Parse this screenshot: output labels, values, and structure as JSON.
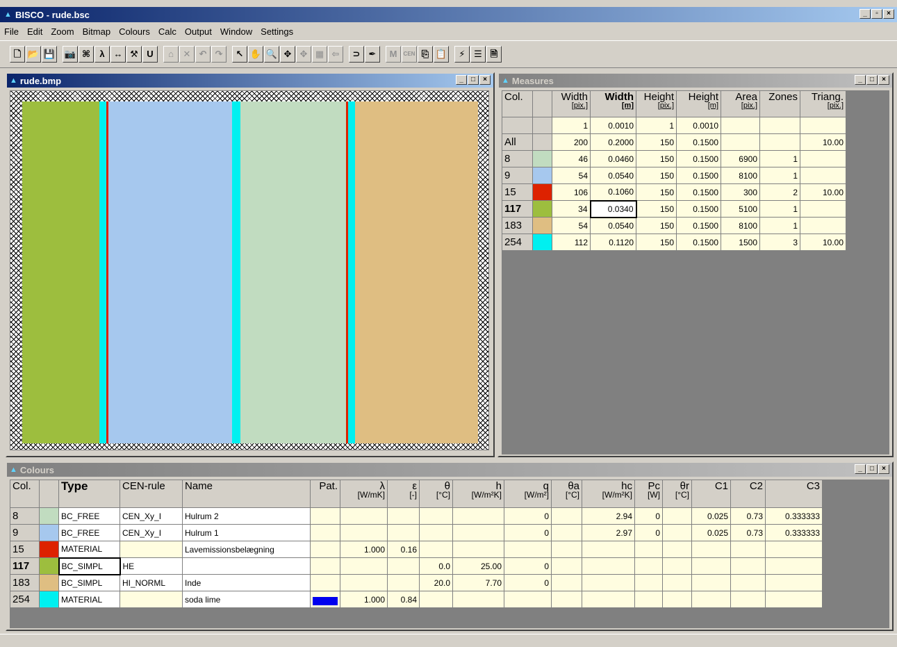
{
  "app": {
    "title": "BISCO - rude.bsc"
  },
  "menu": [
    "File",
    "Edit",
    "Zoom",
    "Bitmap",
    "Colours",
    "Calc",
    "Output",
    "Window",
    "Settings"
  ],
  "toolbar": [
    {
      "glyph": "🗋",
      "name": "new-icon"
    },
    {
      "glyph": "📂",
      "name": "open-icon"
    },
    {
      "glyph": "💾",
      "name": "save-icon"
    },
    {
      "sep": true
    },
    {
      "glyph": "📷",
      "name": "camera-icon"
    },
    {
      "glyph": "⌘",
      "name": "nodes-icon"
    },
    {
      "glyph": "λ",
      "name": "lambda-icon"
    },
    {
      "glyph": "↔",
      "name": "measure-icon"
    },
    {
      "glyph": "⚒",
      "name": "tools-icon"
    },
    {
      "glyph": "U",
      "name": "u-value-icon"
    },
    {
      "sep": true
    },
    {
      "glyph": "⌂",
      "name": "eraser-icon",
      "dis": true
    },
    {
      "glyph": "✕",
      "name": "delete-icon",
      "dis": true
    },
    {
      "glyph": "↶",
      "name": "undo-icon",
      "dis": true
    },
    {
      "glyph": "↷",
      "name": "redo-icon",
      "dis": true
    },
    {
      "sep": true
    },
    {
      "glyph": "↖",
      "name": "pointer-icon"
    },
    {
      "glyph": "✋",
      "name": "hand-icon"
    },
    {
      "glyph": "🔍",
      "name": "zoom-icon"
    },
    {
      "glyph": "✥",
      "name": "move-icon"
    },
    {
      "glyph": "✥",
      "name": "move2-icon",
      "dis": true
    },
    {
      "glyph": "▦",
      "name": "fill-icon",
      "dis": true
    },
    {
      "glyph": "⇦",
      "name": "back-icon",
      "dis": true
    },
    {
      "sep": true
    },
    {
      "glyph": "⊃",
      "name": "curve-icon"
    },
    {
      "glyph": "✒",
      "name": "brush-icon"
    },
    {
      "sep": true
    },
    {
      "glyph": "M",
      "name": "m-icon",
      "dis": true
    },
    {
      "glyph": "CEN",
      "name": "cen-icon",
      "dis": true,
      "small": true
    },
    {
      "glyph": "⎘",
      "name": "copy-icon"
    },
    {
      "glyph": "📋",
      "name": "paste-icon"
    },
    {
      "sep": true
    },
    {
      "glyph": "⚡",
      "name": "wand-icon"
    },
    {
      "glyph": "☰",
      "name": "colours-icon"
    },
    {
      "glyph": "🗎",
      "name": "report-icon"
    }
  ],
  "bitmap_window": {
    "title": "rude.bmp"
  },
  "measures_window": {
    "title": "Measures",
    "headers": [
      {
        "t": "Col.",
        "u": ""
      },
      {
        "t": "",
        "u": ""
      },
      {
        "t": "Width",
        "u": "[pix.]"
      },
      {
        "t": "Width",
        "u": "[m]",
        "bold": true
      },
      {
        "t": "Height",
        "u": "[pix.]"
      },
      {
        "t": "Height",
        "u": "[m]"
      },
      {
        "t": "Area",
        "u": "[pix.]"
      },
      {
        "t": "Zones",
        "u": ""
      },
      {
        "t": "Triang.",
        "u": "[pix.]"
      }
    ],
    "rows": [
      {
        "col": "",
        "color": "#d4d0c8",
        "v": [
          "1",
          "0.0010",
          "1",
          "0.0010",
          "",
          "",
          ""
        ]
      },
      {
        "col": "All",
        "color": "#d4d0c8",
        "v": [
          "200",
          "0.2000",
          "150",
          "0.1500",
          "",
          "",
          "10.00"
        ]
      },
      {
        "col": "8",
        "color": "#c1dcc0",
        "v": [
          "46",
          "0.0460",
          "150",
          "0.1500",
          "6900",
          "1",
          ""
        ]
      },
      {
        "col": "9",
        "color": "#a6c8ee",
        "v": [
          "54",
          "0.0540",
          "150",
          "0.1500",
          "8100",
          "1",
          ""
        ]
      },
      {
        "col": "15",
        "color": "#dd2200",
        "v": [
          "106",
          "0.1060",
          "150",
          "0.1500",
          "300",
          "2",
          "10.00"
        ]
      },
      {
        "col": "117",
        "color": "#9dbe3e",
        "v": [
          "34",
          "0.0340",
          "150",
          "0.1500",
          "5100",
          "1",
          ""
        ],
        "bold": true
      },
      {
        "col": "183",
        "color": "#dfbe82",
        "v": [
          "54",
          "0.0540",
          "150",
          "0.1500",
          "8100",
          "1",
          ""
        ]
      },
      {
        "col": "254",
        "color": "#00f0f0",
        "v": [
          "112",
          "0.1120",
          "150",
          "0.1500",
          "1500",
          "3",
          "10.00"
        ]
      }
    ]
  },
  "colours_window": {
    "title": "Colours",
    "headers": [
      {
        "t": "Col.",
        "u": ""
      },
      {
        "t": "",
        "u": ""
      },
      {
        "t": "Type",
        "u": "",
        "bold": true
      },
      {
        "t": "CEN-rule",
        "u": ""
      },
      {
        "t": "Name",
        "u": ""
      },
      {
        "t": "Pat.",
        "u": ""
      },
      {
        "t": "λ",
        "u": "[W/mK]"
      },
      {
        "t": "ε",
        "u": "[-]"
      },
      {
        "t": "θ",
        "u": "[°C]"
      },
      {
        "t": "h",
        "u": "[W/m²K]"
      },
      {
        "t": "q",
        "u": "[W/m²]"
      },
      {
        "t": "θa",
        "u": "[°C]"
      },
      {
        "t": "hc",
        "u": "[W/m²K]"
      },
      {
        "t": "Pc",
        "u": "[W]"
      },
      {
        "t": "θr",
        "u": "[°C]"
      },
      {
        "t": "C1",
        "u": ""
      },
      {
        "t": "C2",
        "u": ""
      },
      {
        "t": "C3",
        "u": ""
      }
    ],
    "rows": [
      {
        "col": "8",
        "color": "#c1dcc0",
        "type": "BC_FREE",
        "cen": "CEN_Xy_I",
        "name": "Hulrum 2",
        "pat": "",
        "v": [
          "",
          "",
          "",
          "",
          "0",
          "",
          "2.94",
          "0",
          "",
          "0.025",
          "0.73",
          "0.333333"
        ]
      },
      {
        "col": "9",
        "color": "#a6c8ee",
        "type": "BC_FREE",
        "cen": "CEN_Xy_I",
        "name": "Hulrum 1",
        "pat": "",
        "v": [
          "",
          "",
          "",
          "",
          "0",
          "",
          "2.97",
          "0",
          "",
          "0.025",
          "0.73",
          "0.333333"
        ]
      },
      {
        "col": "15",
        "color": "#dd2200",
        "type": "MATERIAL",
        "cen": "",
        "name": "Lavemissionsbelægning",
        "pat": "",
        "v": [
          "1.000",
          "0.16",
          "",
          "",
          "",
          "",
          "",
          "",
          "",
          "",
          "",
          ""
        ]
      },
      {
        "col": "117",
        "color": "#9dbe3e",
        "type": "BC_SIMPL",
        "cen": "HE",
        "name": "",
        "pat": "",
        "v": [
          "",
          "",
          "0.0",
          "25.00",
          "0",
          "",
          "",
          "",
          "",
          "",
          "",
          ""
        ],
        "bold": true
      },
      {
        "col": "183",
        "color": "#dfbe82",
        "type": "BC_SIMPL",
        "cen": "HI_NORML",
        "name": "Inde",
        "pat": "",
        "v": [
          "",
          "",
          "20.0",
          "7.70",
          "0",
          "",
          "",
          "",
          "",
          "",
          "",
          ""
        ]
      },
      {
        "col": "254",
        "color": "#00f0f0",
        "type": "MATERIAL",
        "cen": "",
        "name": "soda lime",
        "pat": "#0000ee",
        "v": [
          "1.000",
          "0.84",
          "",
          "",
          "",
          "",
          "",
          "",
          "",
          "",
          "",
          ""
        ]
      }
    ]
  },
  "bitmap_strips": [
    {
      "name": "strip-green",
      "color": "#9dbe3e",
      "w": 111
    },
    {
      "name": "strip-cyan",
      "color": "#00f0f0",
      "w": 10
    },
    {
      "name": "strip-red",
      "color": "#dd2200",
      "w": 3
    },
    {
      "name": "strip-blue",
      "color": "#a6c8ee",
      "w": 178
    },
    {
      "name": "strip-cyan",
      "color": "#00f0f0",
      "w": 12
    },
    {
      "name": "strip-mint",
      "color": "#c1dcc0",
      "w": 152
    },
    {
      "name": "strip-red",
      "color": "#dd2200",
      "w": 3
    },
    {
      "name": "strip-cyan",
      "color": "#00f0f0",
      "w": 10
    },
    {
      "name": "strip-tan",
      "color": "#dfbe82",
      "w": 177
    }
  ]
}
